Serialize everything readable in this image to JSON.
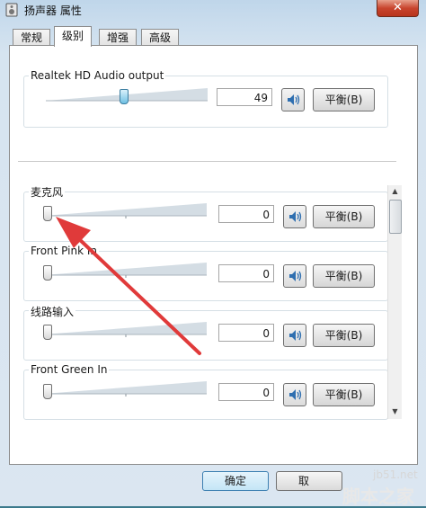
{
  "window": {
    "title": "扬声器 属性",
    "close_label": "✕"
  },
  "tabs": [
    {
      "label": "常规",
      "active": false
    },
    {
      "label": "级别",
      "active": true
    },
    {
      "label": "增强",
      "active": false
    },
    {
      "label": "高级",
      "active": false
    }
  ],
  "master": {
    "label": "Realtek HD Audio output",
    "value": "49",
    "level_percent": 49,
    "balance_label": "平衡(B)"
  },
  "inputs": [
    {
      "label": "麦克风",
      "value": "0",
      "level_percent": 0,
      "balance_label": "平衡(B)"
    },
    {
      "label": "Front Pink In",
      "value": "0",
      "level_percent": 0,
      "balance_label": "平衡(B)"
    },
    {
      "label": "线路输入",
      "value": "0",
      "level_percent": 0,
      "balance_label": "平衡(B)"
    },
    {
      "label": "Front Green In",
      "value": "0",
      "level_percent": 0,
      "balance_label": "平衡(B)"
    }
  ],
  "footer": {
    "ok_label": "确定",
    "cancel_label": "取"
  },
  "watermark": {
    "url": "jb51.net",
    "text": "脚本之家"
  },
  "colors": {
    "arrow": "#e03a3a",
    "accent": "#3c7fb1"
  },
  "icons": {
    "speaker": "speaker-icon",
    "app": "speaker-properties-icon"
  }
}
